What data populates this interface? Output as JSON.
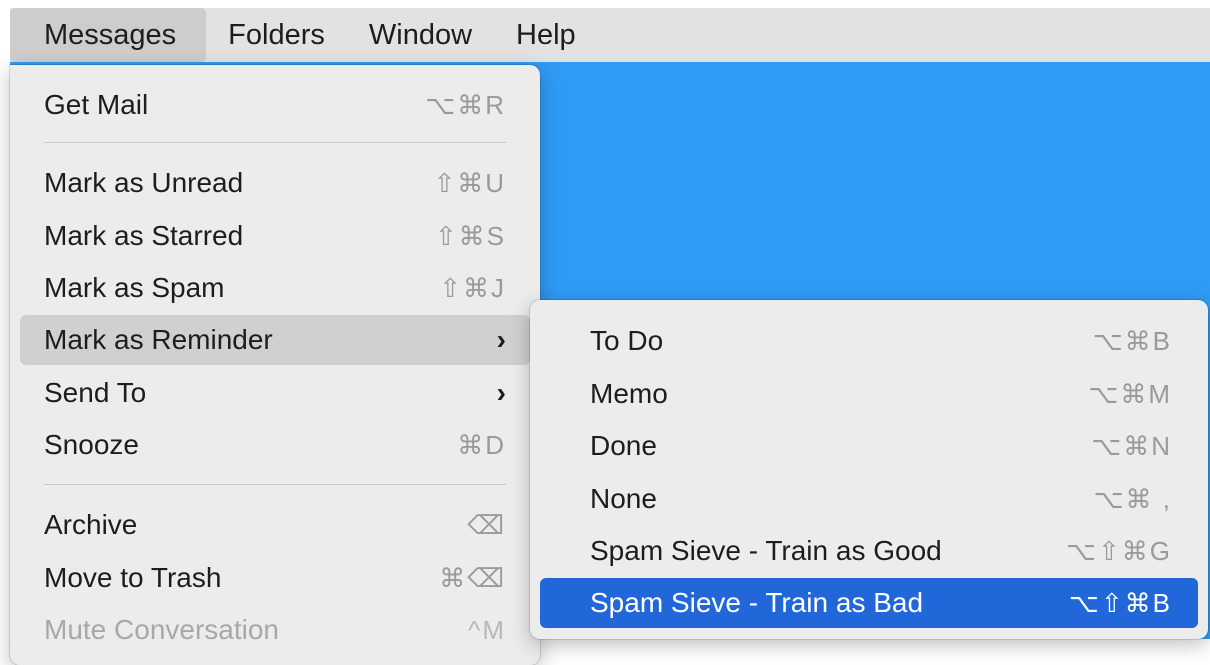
{
  "menubar": {
    "items": [
      {
        "label": "Messages"
      },
      {
        "label": "Folders"
      },
      {
        "label": "Window"
      },
      {
        "label": "Help"
      }
    ]
  },
  "colors": {
    "menubar_bg": "#e2e2e2",
    "menu_bg": "#ececec",
    "backdrop": "#2f9bf5",
    "selection": "#2167da",
    "hover": "#d0d0d0"
  },
  "messages_menu": {
    "items": [
      {
        "label": "Get Mail",
        "shortcut": "⌥⌘R"
      },
      {
        "label": "Mark as Unread",
        "shortcut": "⇧⌘U"
      },
      {
        "label": "Mark as Starred",
        "shortcut": "⇧⌘S"
      },
      {
        "label": "Mark as Spam",
        "shortcut": "⇧⌘J"
      },
      {
        "label": "Mark as Reminder",
        "shortcut": "›",
        "state": "hover"
      },
      {
        "label": "Send To",
        "shortcut": "›"
      },
      {
        "label": "Snooze",
        "shortcut": "⌘D"
      },
      {
        "label": "Archive",
        "shortcut": "⌫"
      },
      {
        "label": "Move to Trash",
        "shortcut": "⌘⌫"
      },
      {
        "label": "Mute Conversation",
        "shortcut": "^M",
        "state": "disabled"
      }
    ]
  },
  "reminder_submenu": {
    "items": [
      {
        "label": "To Do",
        "shortcut": "⌥⌘B"
      },
      {
        "label": "Memo",
        "shortcut": "⌥⌘M"
      },
      {
        "label": "Done",
        "shortcut": "⌥⌘N"
      },
      {
        "label": "None",
        "shortcut": "⌥⌘ ,"
      },
      {
        "label": "Spam Sieve - Train as Good",
        "shortcut": "⌥⇧⌘G"
      },
      {
        "label": "Spam Sieve - Train as Bad",
        "shortcut": "⌥⇧⌘B",
        "state": "selected"
      }
    ]
  }
}
